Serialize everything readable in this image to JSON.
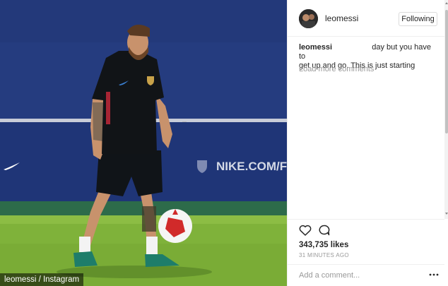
{
  "photo": {
    "caption": "leomessi / Instagram",
    "banner_text": "NIKE.COM/FC"
  },
  "post": {
    "username": "leomessi",
    "follow_label": "Following",
    "comment": {
      "username": "leomessi",
      "text_line1": "day but you have to",
      "text_line2": "get up and go. This is just starting"
    },
    "load_more_label": "Load more comments",
    "likes": "343,735 likes",
    "time": "31 MINUTES AGO",
    "add_comment_placeholder": "Add a comment...",
    "icons": [
      "heart-icon",
      "comment-bubble-icon",
      "more-options-icon"
    ]
  },
  "colors": {
    "text": "#262626",
    "muted": "#999999",
    "border": "#efefef",
    "grass": "#7fb23a",
    "wall": "#233a7a"
  }
}
